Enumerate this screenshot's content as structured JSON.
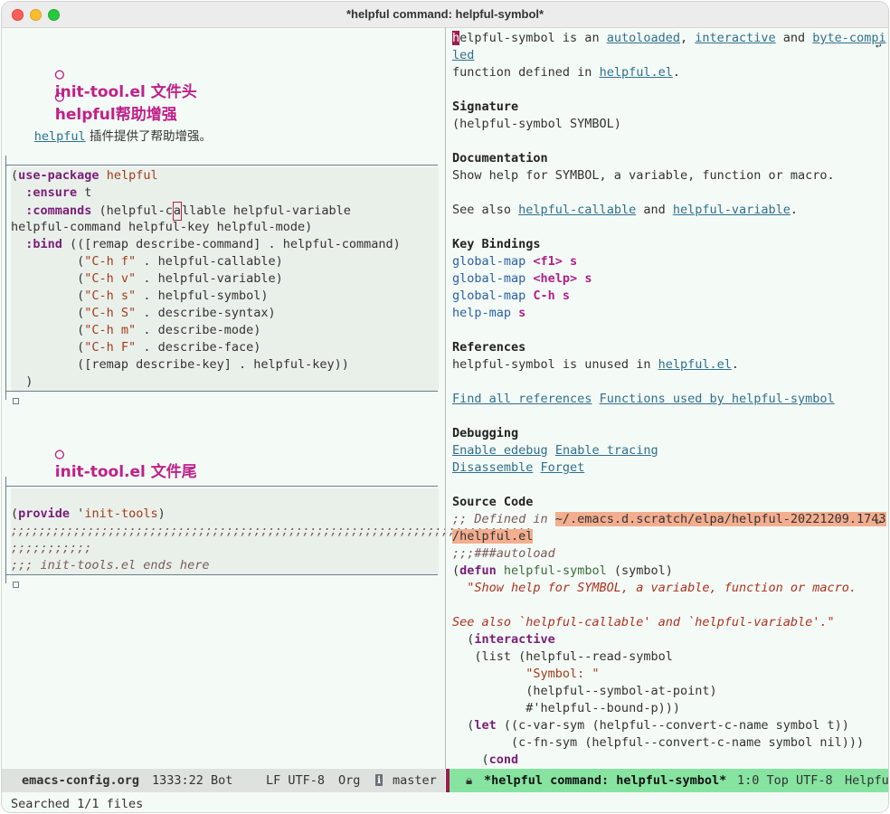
{
  "window": {
    "title": "*helpful command: helpful-symbol*"
  },
  "left": {
    "heading1": "init-tool.el 文件头",
    "heading1_marker": "▾",
    "heading2": "helpful帮助增强",
    "para_link": "helpful",
    "para_text": " 插件提供了帮助增强。",
    "block1_lang": "emacs-lisp",
    "block2_lang": "emacs-lisp",
    "heading3": "init-tool.el 文件尾",
    "code1": [
      "(use-package helpful",
      "  :ensure t",
      "  :commands (helpful-callable helpful-variable",
      "helpful-command helpful-key helpful-mode)",
      "  :bind (([remap describe-command] . helpful-command)",
      "         (\"C-h f\" . helpful-callable)",
      "         (\"C-h v\" . helpful-variable)",
      "         (\"C-h s\" . helpful-symbol)",
      "         (\"C-h S\" . describe-syntax)",
      "         (\"C-h m\" . describe-mode)",
      "         (\"C-h F\" . describe-face)",
      "         ([remap describe-key] . helpful-key))",
      "  )"
    ],
    "code2": [
      "(provide 'init-tools)",
      ";;;;;;;;;;;;;;;;;;;;;;;;;;;;;;;;;;;;;;;;;;;;;;;;;;;;;;;;;;;;;;;;;;;;;;;;;;;",
      ";;;;;;;;;;;",
      ";;; init-tools.el ends here"
    ]
  },
  "right": {
    "intro_l1_a": "helpful-symbol is an ",
    "intro_l1_link1": "autoloaded",
    "intro_l1_b": ", ",
    "intro_l1_link2": "interactive",
    "intro_l1_c": " and ",
    "intro_l1_link3": "byte-compi",
    "intro_l2_link": "led",
    "intro_l3_a": "function defined in ",
    "intro_l3_link": "helpful.el",
    "intro_l3_b": ".",
    "sig_title": "Signature",
    "sig_text": "(helpful-symbol SYMBOL)",
    "doc_title": "Documentation",
    "doc_text": "Show help for SYMBOL, a variable, function or macro.",
    "seealso_a": "See also ",
    "seealso_link1": "helpful-callable",
    "seealso_b": " and ",
    "seealso_link2": "helpful-variable",
    "seealso_c": ".",
    "kb_title": "Key Bindings",
    "keybindings": [
      {
        "map": "global-map",
        "key": "<f1> s"
      },
      {
        "map": "global-map",
        "key": "<help> s"
      },
      {
        "map": "global-map",
        "key": "C-h s"
      },
      {
        "map": "help-map",
        "key": "s"
      }
    ],
    "ref_title": "References",
    "ref_a": "helpful-symbol is unused in ",
    "ref_link": "helpful.el",
    "ref_b": ".",
    "find_all": "Find all references",
    "functions_used": "Functions used by helpful-symbol",
    "dbg_title": "Debugging",
    "enable_edebug": "Enable edebug",
    "enable_tracing": "Enable tracing",
    "disassemble": "Disassemble",
    "forget": "Forget",
    "src_title": "Source Code",
    "src_defined_cmt": ";; Defined in ",
    "src_path1": "~/.emacs.d.scratch/elpa/helpful-20221209.1743",
    "src_path2": "/helpful.el",
    "src_autoload": ";;;###autoload",
    "src_lines": [
      "(defun helpful-symbol (symbol)",
      "  \"Show help for SYMBOL, a variable, function or macro.",
      "",
      "See also `helpful-callable' and `helpful-variable'.\"",
      "  (interactive",
      "   (list (helpful--read-symbol",
      "          \"Symbol: \"",
      "          (helpful--symbol-at-point)",
      "          #'helpful--bound-p)))",
      "  (let ((c-var-sym (helpful--convert-c-name symbol t))",
      "        (c-fn-sym (helpful--convert-c-name symbol nil)))",
      "    (cond"
    ]
  },
  "modeline_left": {
    "buffer": "emacs-config.org",
    "position": "1333:22 Bot",
    "encoding": "LF UTF-8",
    "mode": "Org",
    "branch": "master"
  },
  "modeline_right": {
    "buffer": "*helpful command: helpful-symbol*",
    "info": "1:0 Top UTF-8",
    "mode": "Helpfu"
  },
  "minibuffer": "Searched 1/1 files"
}
